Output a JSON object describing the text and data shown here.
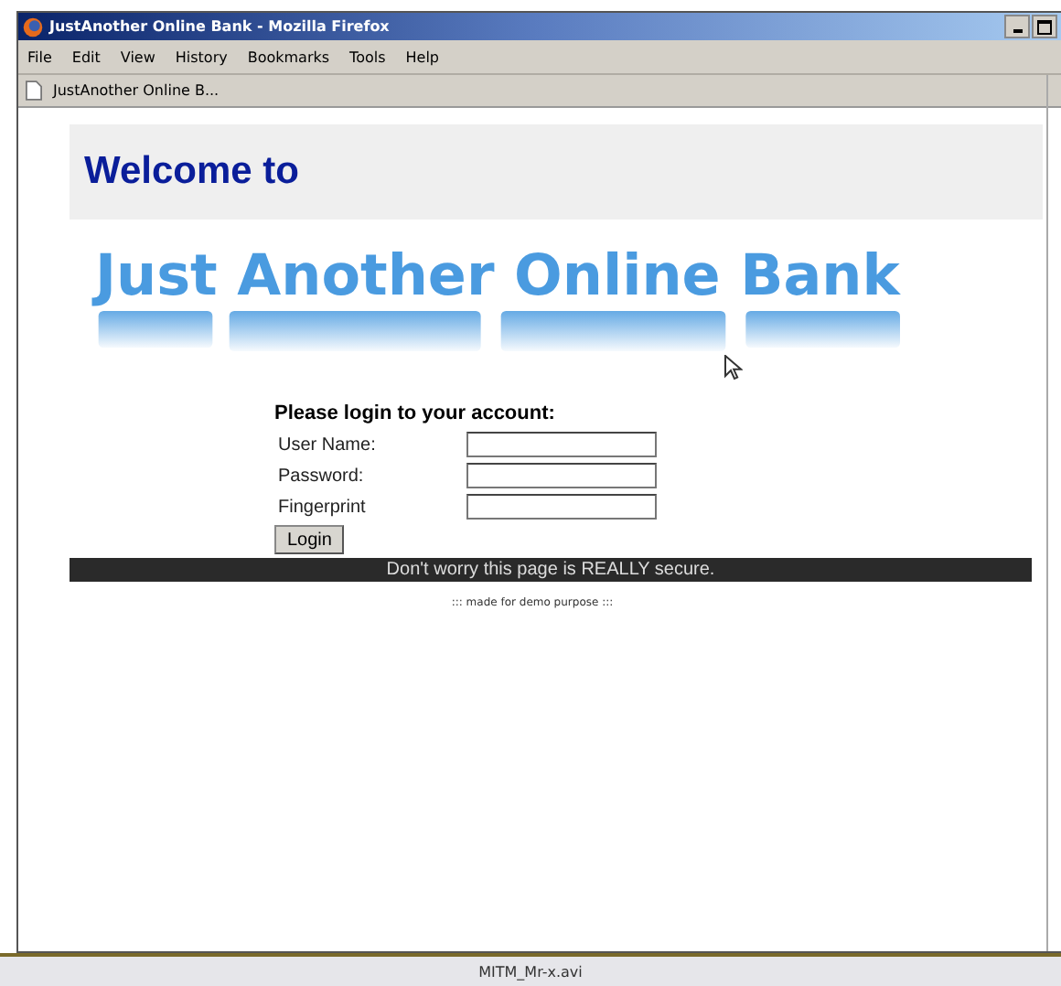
{
  "window": {
    "title": "JustAnother Online Bank - Mozilla Firefox"
  },
  "menu": [
    {
      "label": "File"
    },
    {
      "label": "Edit"
    },
    {
      "label": "View"
    },
    {
      "label": "History"
    },
    {
      "label": "Bookmarks"
    },
    {
      "label": "Tools"
    },
    {
      "label": "Help"
    }
  ],
  "tab": {
    "label": "JustAnother Online B..."
  },
  "page": {
    "heading": "Welcome to",
    "logo": "Just Another Online Bank",
    "form": {
      "title": "Please login to your account:",
      "fields": [
        {
          "label": "User Name:"
        },
        {
          "label": "Password:"
        },
        {
          "label": "Fingerprint"
        }
      ],
      "button": "Login"
    },
    "banner": "Don't worry this page is REALLY secure.",
    "footer": "::: made for demo purpose :::"
  },
  "status_bar": {
    "text": "MITM_Mr-x.avi"
  }
}
